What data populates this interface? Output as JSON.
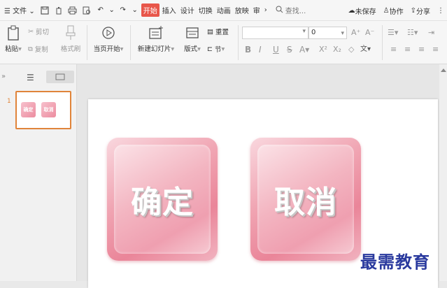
{
  "menu": {
    "file_label": "文件",
    "tabs": [
      {
        "label": "开始",
        "active": true
      },
      {
        "label": "插入",
        "active": false
      },
      {
        "label": "设计",
        "active": false
      },
      {
        "label": "切换",
        "active": false
      },
      {
        "label": "动画",
        "active": false
      },
      {
        "label": "放映",
        "active": false
      },
      {
        "label": "审",
        "active": false
      }
    ],
    "more_tabs": "›",
    "search_placeholder": "查找...",
    "unsaved": "未保存",
    "collaborate": "协作",
    "share": "分享"
  },
  "ribbon": {
    "paste": "粘贴",
    "cut": "剪切",
    "copy": "复制",
    "format_painter": "格式刷",
    "play_from_current": "当页开始",
    "new_slide": "新建幻灯片",
    "layout": "版式",
    "section": "节",
    "reset": "重置",
    "font_name": "",
    "font_size": "0"
  },
  "slides_panel": {
    "slide_number": "1",
    "mini_buttons": [
      "确定",
      "取消"
    ]
  },
  "slide": {
    "buttons": [
      "确定",
      "取消"
    ]
  },
  "watermark": "最需教育",
  "colors": {
    "accent": "#e8564a",
    "thumb_border": "#e0843a",
    "tile_pink": "#ef9fb0",
    "watermark": "#2a3a9e"
  }
}
